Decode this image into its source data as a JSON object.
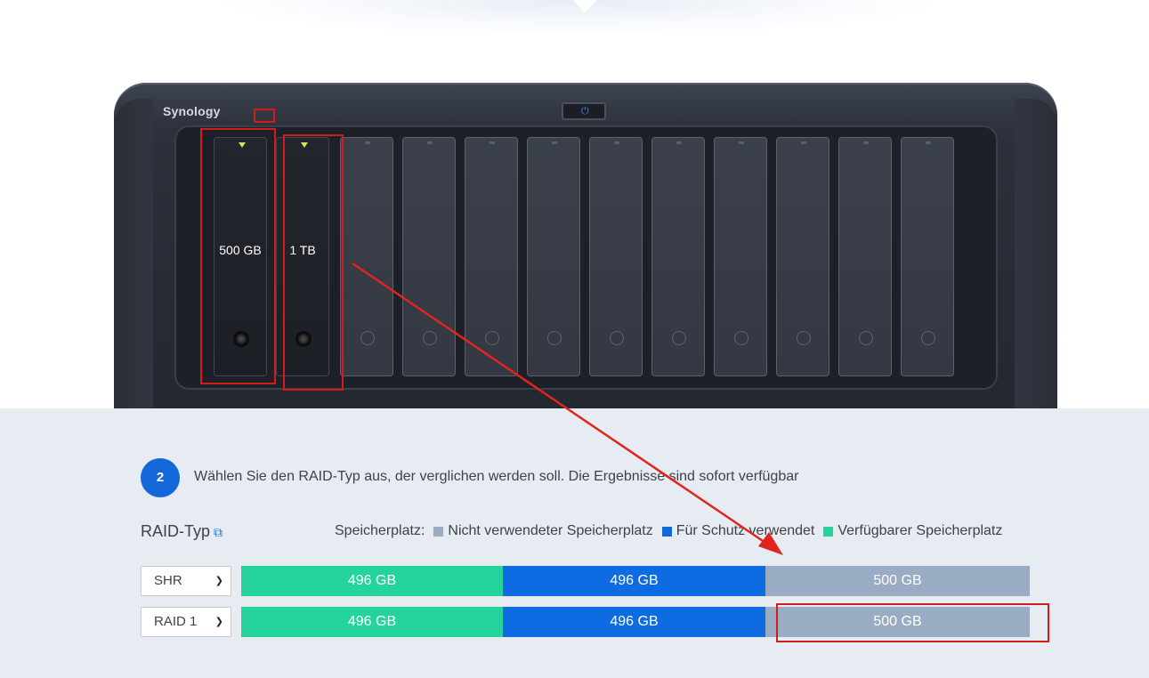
{
  "device": {
    "brand": "Synology",
    "drives": [
      {
        "capacity": "500 GB"
      },
      {
        "capacity": "1 TB"
      }
    ],
    "empty_bays": 10
  },
  "step": {
    "number": "2",
    "text": "Wählen Sie den RAID-Typ aus, der verglichen werden soll. Die Ergebnisse sind sofort verfügbar"
  },
  "raid": {
    "label": "RAID-Typ",
    "legend_title": "Speicherplatz:",
    "legend": [
      {
        "label": "Nicht verwendeter Speicherplatz",
        "color": "#9aabc4"
      },
      {
        "label": "Für Schutz verwendet",
        "color": "#1467d8"
      },
      {
        "label": "Verfügbarer Speicherplatz",
        "color": "#25d49d"
      }
    ],
    "rows": [
      {
        "type": "SHR",
        "available": "496 GB",
        "protection": "496 GB",
        "unused": "500 GB"
      },
      {
        "type": "RAID 1",
        "available": "496 GB",
        "protection": "496 GB",
        "unused": "500 GB"
      }
    ]
  },
  "colors": {
    "accent": "#1467d8",
    "available": "#25d49d",
    "protection": "#0e6be1",
    "unused": "#9aabc4",
    "annotation": "#d01c1c"
  }
}
